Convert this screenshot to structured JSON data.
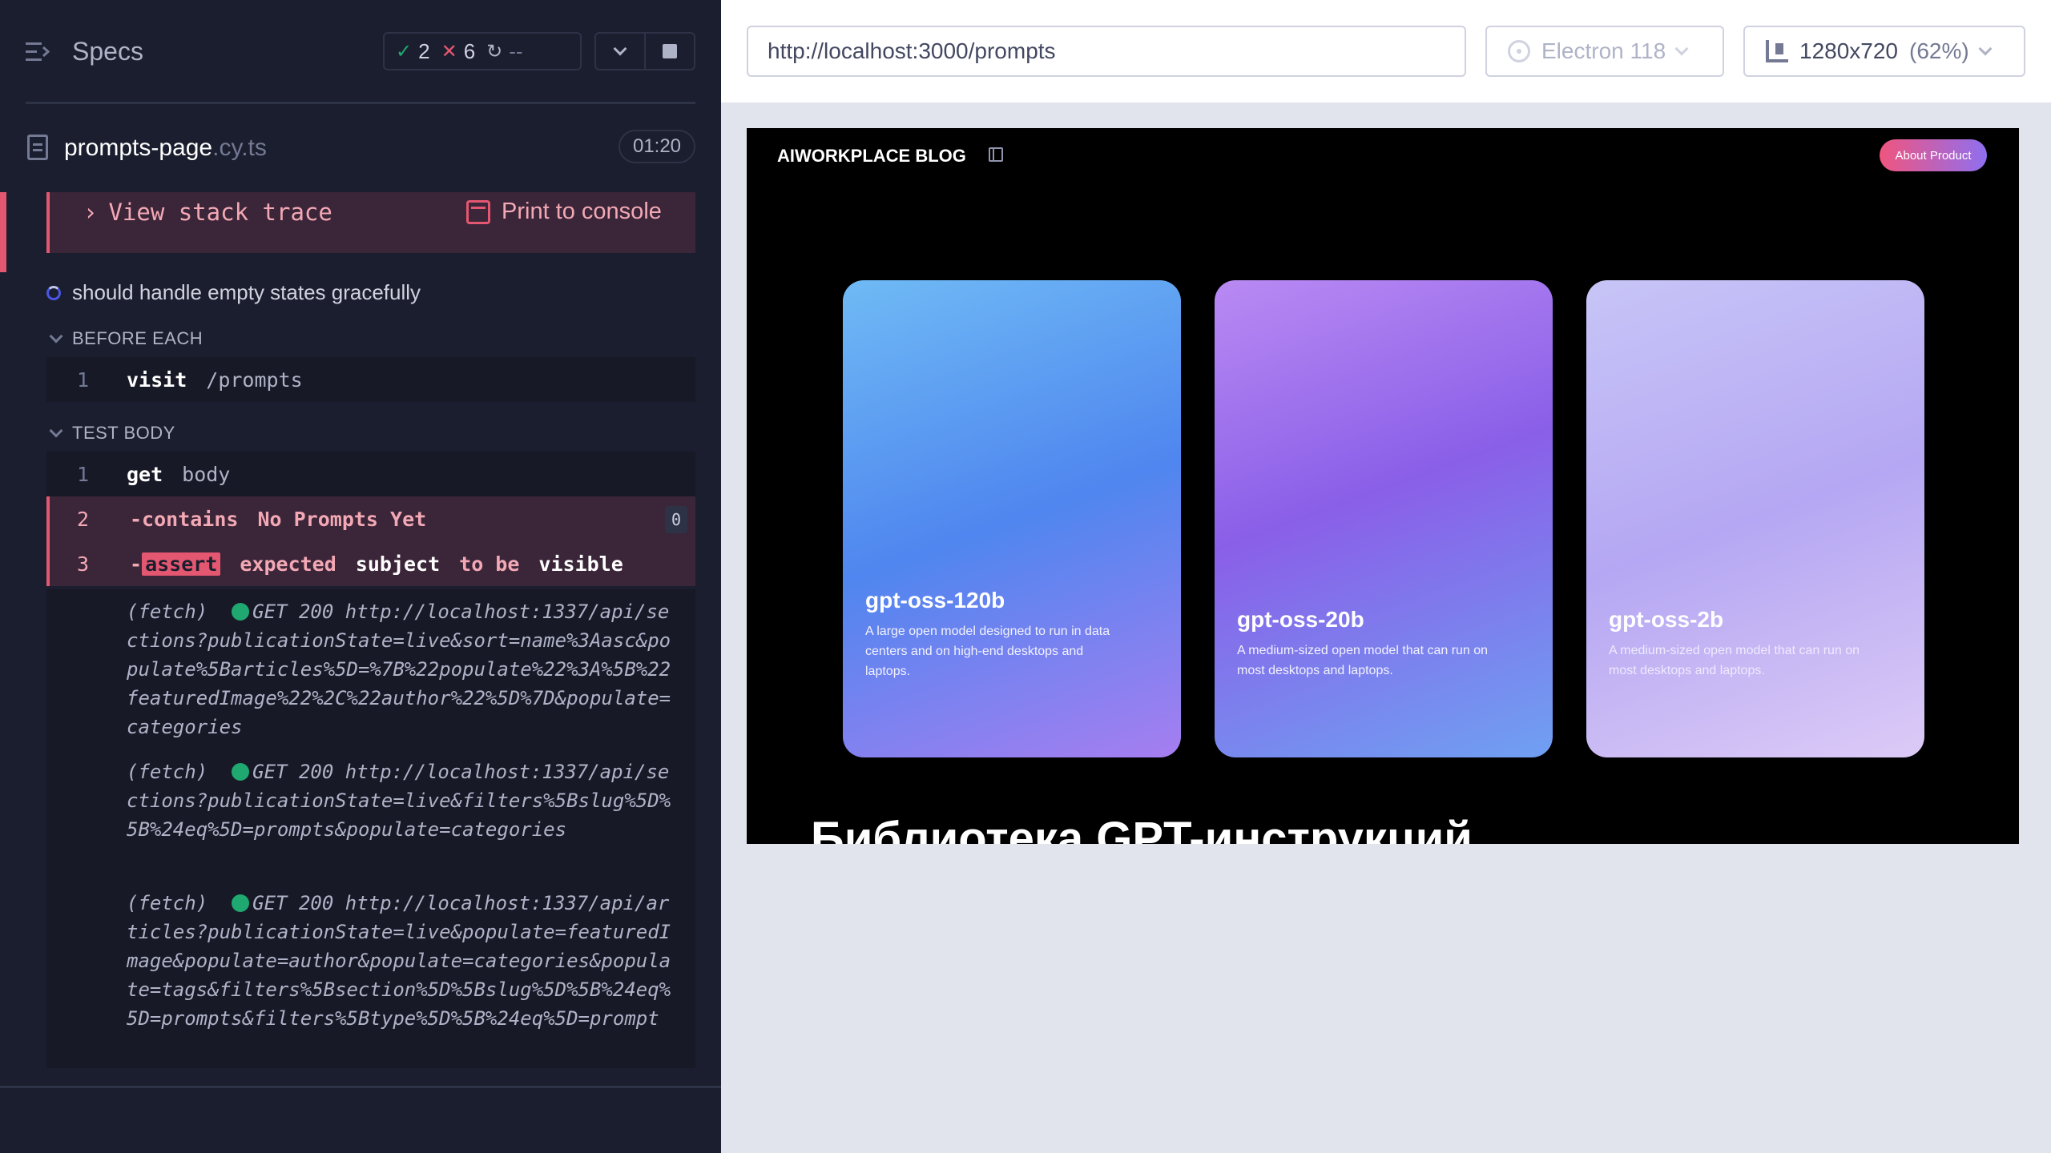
{
  "reporter": {
    "title": "Specs",
    "stats": {
      "passed": "2",
      "failed": "6",
      "pending": "--"
    },
    "spec": {
      "name": "prompts-page",
      "ext": ".cy.ts",
      "duration": "01:20"
    },
    "error": {
      "stack_trace_label": "View stack trace",
      "print_console_label": "Print to console"
    },
    "test_title": "should handle empty states gracefully",
    "before_each": {
      "label": "BEFORE EACH",
      "commands": [
        {
          "num": "1",
          "name": "visit",
          "message": "/prompts"
        }
      ]
    },
    "test_body": {
      "label": "TEST BODY",
      "commands": [
        {
          "num": "1",
          "name": "get",
          "message": "body"
        },
        {
          "num": "2",
          "name": "-contains",
          "message": "No Prompts Yet",
          "count": "0"
        },
        {
          "num": "3",
          "prefix": "-",
          "name": "assert",
          "msg_a": "expected",
          "msg_b": "subject",
          "msg_c": "to be",
          "msg_d": "visible"
        }
      ]
    },
    "logs": [
      {
        "type": "(fetch)",
        "status": "GET 200",
        "url": "http://localhost:1337/api/sections?publicationState=live&sort=name%3Aasc&populate%5Barticles%5D=%7B%22populate%22%3A%5B%22featuredImage%22%2C%22author%22%5D%7D&populate=categories"
      },
      {
        "type": "(fetch)",
        "status": "GET 200",
        "url": "http://localhost:1337/api/sections?publicationState=live&filters%5Bslug%5D%5B%24eq%5D=prompts&populate=categories"
      },
      {
        "type": "(fetch)",
        "status": "GET 200",
        "url": "http://localhost:1337/api/articles?publicationState=live&populate=featuredImage&populate=author&populate=categories&populate=tags&filters%5Bsection%5D%5Bslug%5D%5B%24eq%5D=prompts&filters%5Btype%5D%5B%24eq%5D=prompt"
      }
    ]
  },
  "aut": {
    "url": "http://localhost:3000/prompts",
    "browser": "Electron 118",
    "viewport": "1280x720",
    "scale": "(62%)"
  },
  "site": {
    "logo": "AIWORKPLACE BLOG",
    "about_button": "About Product",
    "cards": [
      {
        "title": "gpt-oss-120b",
        "desc": "A large open model designed to run in data centers and on high-end desktops and laptops."
      },
      {
        "title": "gpt-oss-20b",
        "desc": "A medium-sized open model that can run on most desktops and laptops."
      },
      {
        "title": "gpt-oss-2b",
        "desc": "A medium-sized open model that can run on most desktops and laptops."
      }
    ],
    "heading": "Библиотека GPT-инструкций"
  },
  "colors": {
    "failed": "#e45770",
    "passed": "#1fa971",
    "running": "#4956e3",
    "panel_bg": "#1b1e2e"
  }
}
